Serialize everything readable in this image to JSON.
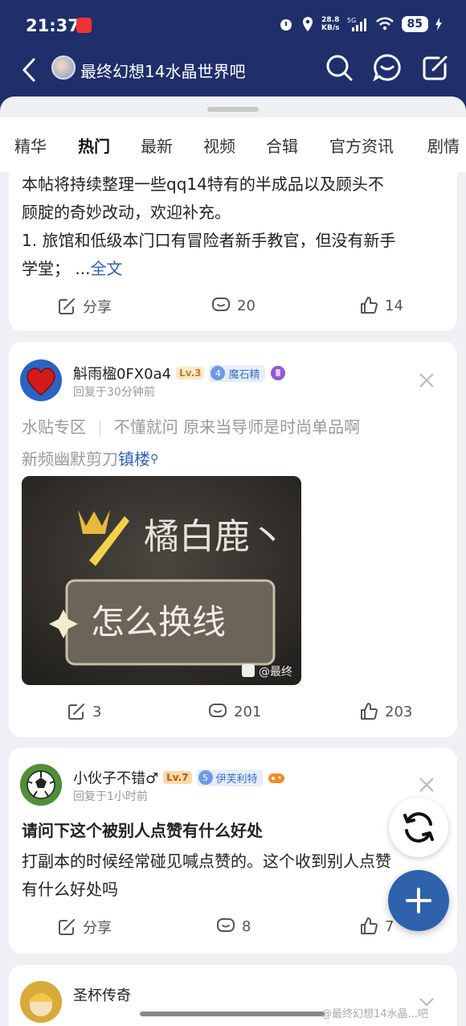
{
  "status_bar": {
    "time": "21:37",
    "net_speed_top": "28.8",
    "net_speed_bottom": "KB/s",
    "signal": "5G",
    "battery": "85"
  },
  "header": {
    "title": "最终幻想14水晶世界吧"
  },
  "tabs": [
    {
      "label": "精华"
    },
    {
      "label": "热门"
    },
    {
      "label": "最新"
    },
    {
      "label": "视频"
    },
    {
      "label": "合辑"
    },
    {
      "label": "官方资讯"
    },
    {
      "label": "剧情"
    }
  ],
  "post1": {
    "lines": [
      "本帖将持续整理一些qq14特有的半成品以及顾头不",
      "顾腚的奇妙改动，欢迎补充。",
      "1. 旅馆和低级本门口有冒险者新手教官，但没有新手"
    ],
    "last_line": "学堂；  ...",
    "more_link": "全文",
    "share": "分享",
    "comments": "20",
    "likes": "14"
  },
  "post2": {
    "username": "斛雨楹0FX0a4",
    "level": "Lv.3",
    "badge_num": "4",
    "badge_name": "魔石精",
    "reply_time": "回复于30分钟前",
    "tag1": "水贴专区",
    "line1": "不懂就问 原来当导师是时尚单品啊",
    "line2": "新频幽默剪刀",
    "link": "镇楼",
    "image_text1": "橘白鹿丶",
    "image_text2": "怎么换线",
    "image_watermark": "@最终",
    "share_count": "3",
    "comments": "201",
    "likes": "203"
  },
  "post3": {
    "username": "小伙子不错♂",
    "level": "Lv.7",
    "badge_num": "5",
    "badge_name": "伊芙利特",
    "reply_time": "回复于1小时前",
    "title": "请问下这个被别人点赞有什么好处",
    "lines": [
      "打副本的时候经常碰见喊点赞的。这个收到别人点赞",
      "有什么好处吗"
    ],
    "share": "分享",
    "comments": "8",
    "likes": "7"
  },
  "post4": {
    "username": "圣杯传奇"
  },
  "watermark": "@最终幻想14水晶...吧",
  "colors": {
    "header_bg": "#1e2f6b",
    "accent": "#2e62ad",
    "link": "#2e5fb8"
  }
}
